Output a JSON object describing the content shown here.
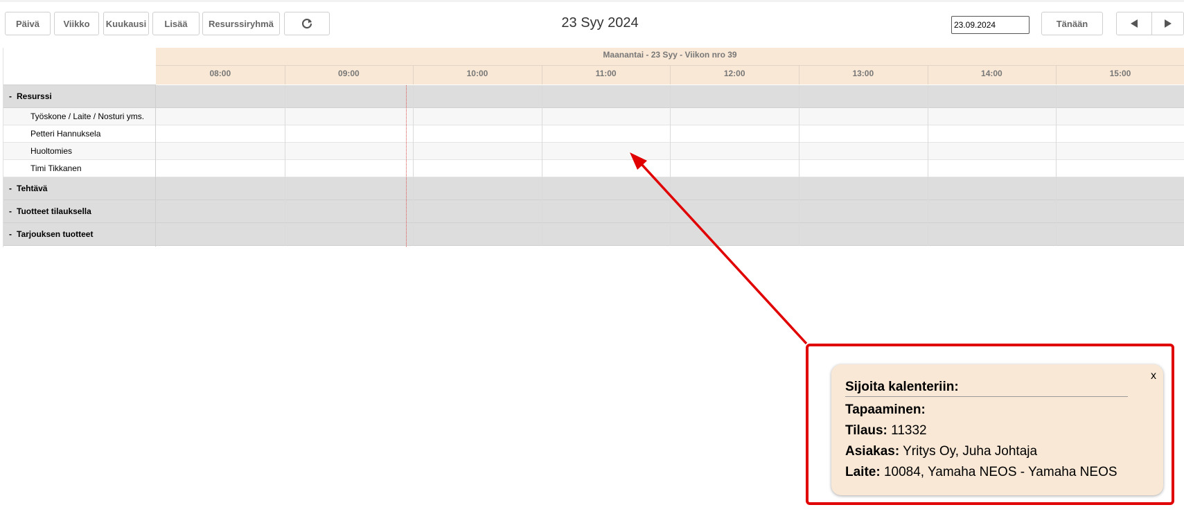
{
  "toolbar": {
    "day_label": "Päivä",
    "week_label": "Viikko",
    "month_label": "Kuukausi",
    "more_label": "Lisää",
    "resource_group_label": "Resurssiryhmä",
    "refresh_icon": "refresh-icon",
    "title": "23 Syy 2024",
    "date_value": "23.09.2024",
    "today_label": "Tänään",
    "prev_icon": "triangle-left-icon",
    "next_icon": "triangle-right-icon"
  },
  "calendar": {
    "day_title": "Maanantai - 23 Syy - Viikon nro 39",
    "hours": [
      "08:00",
      "09:00",
      "10:00",
      "11:00",
      "12:00",
      "13:00",
      "14:00",
      "15:00"
    ],
    "groups": [
      {
        "toggle": "-",
        "label": "Resurssi",
        "items": [
          "Työskone / Laite / Nosturi yms.",
          "Petteri Hannuksela",
          "Huoltomies",
          "Timi Tikkanen"
        ]
      },
      {
        "toggle": "-",
        "label": "Tehtävä",
        "items": []
      },
      {
        "toggle": "-",
        "label": "Tuotteet tilauksella",
        "items": []
      },
      {
        "toggle": "-",
        "label": "Tarjouksen tuotteet",
        "items": []
      }
    ],
    "now_line_color": "#d9534f",
    "header_color": "#f9e8d5",
    "group_row_color": "#dddddd"
  },
  "popup": {
    "close_label": "x",
    "title": "Sijoita kalenteriin:",
    "meeting_label": "Tapaaminen:",
    "order_label": "Tilaus:",
    "order_value": "11332",
    "customer_label": "Asiakas:",
    "customer_value": "Yritys Oy, Juha Johtaja",
    "device_label": "Laite:",
    "device_value": "10084, Yamaha NEOS - Yamaha NEOS",
    "background_color": "#f9e8d5",
    "highlight_color": "#e00000"
  }
}
